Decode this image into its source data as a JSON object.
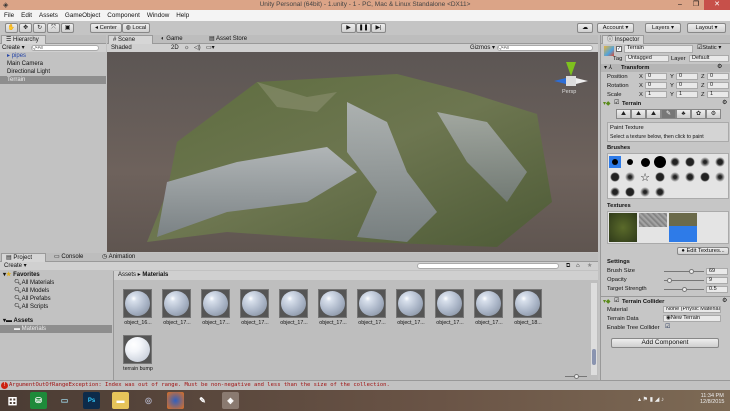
{
  "window": {
    "title": "Unity Personal (64bit) - 1.unity - 1 - PC, Mac & Linux Standalone <DX11>",
    "min": "–",
    "max": "❐",
    "close": "✕"
  },
  "menu": [
    "File",
    "Edit",
    "Assets",
    "GameObject",
    "Component",
    "Window",
    "Help"
  ],
  "toolbar": {
    "center": "Center",
    "local": "Local",
    "account": "Account",
    "layers": "Layers",
    "layout": "Layout"
  },
  "hierarchy": {
    "tab": "Hierarchy",
    "create": "Create",
    "search_placeholder": "Q•All",
    "items": [
      "pipes",
      "Main Camera",
      "Directional Light",
      "Terrain"
    ]
  },
  "scene": {
    "tabs": [
      "Scene",
      "Game",
      "Asset Store"
    ],
    "shading": "Shaded",
    "mode2d": "2D",
    "gizmos": "Gizmos",
    "search_placeholder": "Q•All",
    "persp": "Persp"
  },
  "inspector": {
    "tab": "Inspector",
    "object_name": "Terrain",
    "static": "Static",
    "tag_label": "Tag",
    "tag": "Untagged",
    "layer_label": "Layer",
    "layer": "Default",
    "transform": {
      "title": "Transform",
      "rows": [
        {
          "label": "Position",
          "x": "0",
          "y": "0",
          "z": "0"
        },
        {
          "label": "Rotation",
          "x": "0",
          "y": "0",
          "z": "0"
        },
        {
          "label": "Scale",
          "x": "1",
          "y": "1",
          "z": "1"
        }
      ]
    },
    "terrain": {
      "title": "Terrain",
      "tool_title": "Paint Texture",
      "tool_hint": "Select a texture below, then click to paint",
      "brushes": "Brushes",
      "textures": "Textures",
      "edit_textures": "Edit Textures...",
      "settings": "Settings",
      "brush_size_label": "Brush Size",
      "brush_size": "69",
      "brush_size_frac": 0.69,
      "opacity_label": "Opacity",
      "opacity": "9",
      "opacity_frac": 0.09,
      "strength_label": "Target Strength",
      "strength": "0.5",
      "strength_frac": 0.5
    },
    "collider": {
      "title": "Terrain Collider",
      "material_label": "Material",
      "material": "None (Physic Material)",
      "data_label": "Terrain Data",
      "data": "New Terrain",
      "tree_label": "Enable Tree Collider"
    },
    "add_component": "Add Component"
  },
  "project": {
    "tabs": [
      "Project",
      "Console",
      "Animation"
    ],
    "create": "Create",
    "favorites": "Favorites",
    "fav_items": [
      "All Materials",
      "All Models",
      "All Prefabs",
      "All Scripts"
    ],
    "assets": "Assets",
    "materials_folder": "Materials",
    "breadcrumb": [
      "Assets",
      "Materials"
    ],
    "materials": [
      "object_16...",
      "object_17...",
      "object_17...",
      "object_17...",
      "object_17...",
      "object_17...",
      "object_17...",
      "object_17...",
      "object_17...",
      "object_17...",
      "object_18...",
      "terrain bump"
    ]
  },
  "status": {
    "error": "ArgumentOutOfRangeException: Index was out of range. Must be non-negative and less than the size of the collection."
  },
  "taskbar": {
    "time": "11:34 PM",
    "date": "12/8/2015",
    "apps": [
      "windows-start",
      "store",
      "desktop",
      "photoshop",
      "file-explorer",
      "chrome",
      "firefox",
      "inkscape",
      "unity"
    ]
  }
}
